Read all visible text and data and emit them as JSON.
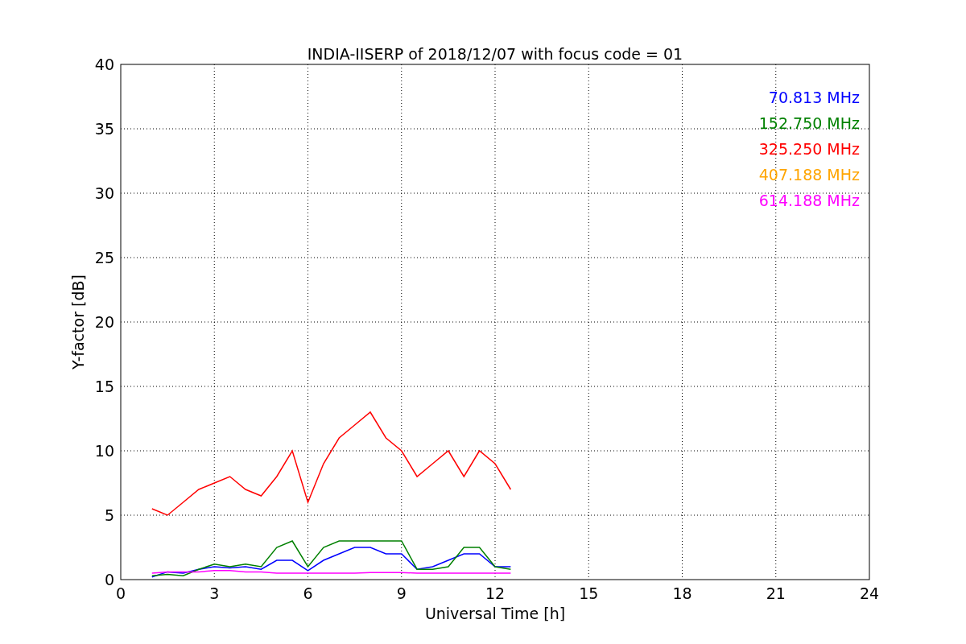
{
  "figure": {
    "chart_data": {
      "type": "line",
      "title": "INDIA-IISERP of 2018/12/07 with focus code = 01",
      "xlabel": "Universal Time [h]",
      "ylabel": "Y-factor [dB]",
      "x": [
        1,
        1.5,
        2,
        2.5,
        3,
        3.5,
        4,
        4.5,
        5,
        5.5,
        6,
        6.5,
        7,
        7.5,
        8,
        8.5,
        9,
        9.5,
        10,
        10.5,
        11,
        11.5,
        12,
        12.5
      ],
      "series": [
        {
          "name": "70.813 MHz",
          "color": "#0000ff",
          "values": [
            0.2,
            0.6,
            0.5,
            0.8,
            1,
            0.9,
            1,
            0.8,
            1.5,
            1.5,
            0.7,
            1.5,
            2,
            2.5,
            2.5,
            2,
            2,
            0.8,
            1,
            1.5,
            2,
            2,
            1,
            1
          ]
        },
        {
          "name": "152.750 MHz",
          "color": "#008000",
          "values": [
            0.3,
            0.4,
            0.3,
            0.8,
            1.2,
            1,
            1.2,
            1,
            2.5,
            3,
            1,
            2.5,
            3,
            3,
            3,
            3,
            3,
            0.8,
            0.8,
            1,
            2.5,
            2.5,
            1,
            0.8
          ]
        },
        {
          "name": "325.250 MHz",
          "color": "#ff0000",
          "values": [
            5.5,
            5,
            6,
            7,
            7.5,
            8,
            7,
            6.5,
            8,
            10,
            6,
            9,
            11,
            12,
            13,
            11,
            10,
            8,
            9,
            10,
            8,
            10,
            9,
            7
          ]
        },
        {
          "name": "407.188 MHz",
          "color": "#ffa500",
          "values": [
            null,
            null,
            null,
            null,
            null,
            null,
            null,
            null,
            null,
            null,
            null,
            null,
            null,
            null,
            null,
            null,
            null,
            null,
            null,
            null,
            null,
            null,
            null,
            null
          ]
        },
        {
          "name": "614.188 MHz",
          "color": "#ff00ff",
          "values": [
            0.5,
            0.6,
            0.6,
            0.6,
            0.7,
            0.7,
            0.6,
            0.6,
            0.5,
            0.5,
            0.5,
            0.5,
            0.5,
            0.5,
            0.55,
            0.55,
            0.55,
            0.5,
            0.5,
            0.5,
            0.5,
            0.5,
            0.5,
            0.5
          ]
        }
      ],
      "grid": true,
      "xlim": [
        0,
        24
      ],
      "ylim": [
        0,
        40
      ],
      "xticks": [
        0,
        3,
        6,
        9,
        12,
        15,
        18,
        21,
        24
      ],
      "yticks": [
        0,
        5,
        10,
        15,
        20,
        25,
        30,
        35,
        40
      ]
    }
  }
}
